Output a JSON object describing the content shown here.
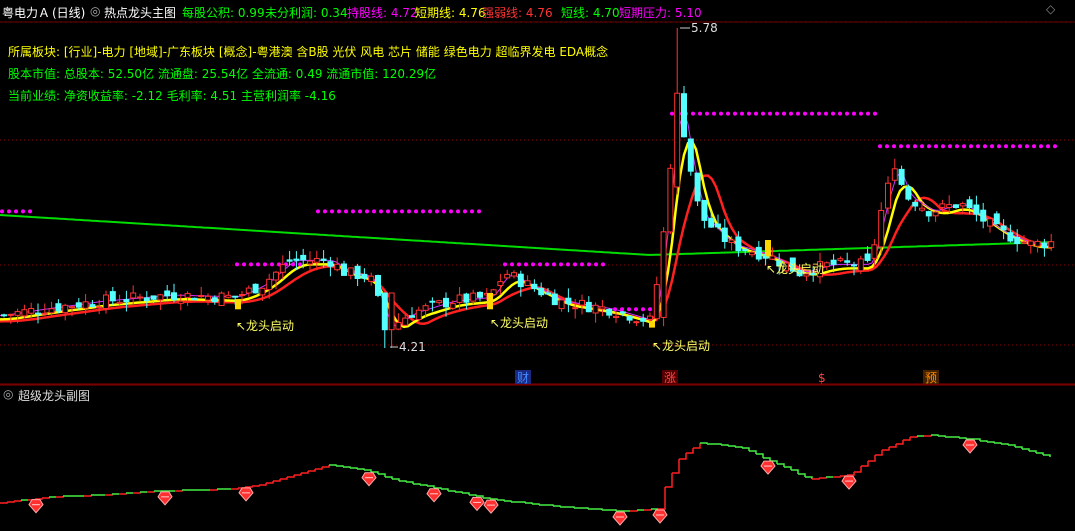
{
  "header": {
    "stock": "粤电力Ａ",
    "period": "(日线)",
    "main_indicator": "热点龙头主图",
    "indicators": [
      {
        "label": "每股公积: 0.99",
        "color": "#00ff00"
      },
      {
        "label": "未分利润: 0.34",
        "color": "#00ff00"
      },
      {
        "label": "持股线: 4.72",
        "color": "#ff00ff"
      },
      {
        "label": "短期线: 4.76",
        "color": "#ffff00"
      },
      {
        "label": "强弱线: 4.76",
        "color": "#ff3333"
      },
      {
        "label": "短线: 4.70",
        "color": "#00ff00"
      },
      {
        "label": "短期压力: 5.10",
        "color": "#ff00ff"
      }
    ]
  },
  "info_lines": {
    "sector": "所属板块: [行业]-电力 [地域]-广东板块 [概念]-粤港澳 含B股 光伏 风电 芯片 储能 绿色电力 超临界发电 EDA概念",
    "capital": "股本市值: 总股本: 52.50亿 流通盘: 25.54亿 全流通: 0.49 流通市值: 120.29亿",
    "performance": "当前业绩: 净资收益率: -2.12 毛利率: 4.51 主营利润率 -4.16"
  },
  "colors": {
    "up": "#ff3232",
    "down": "#54ffff",
    "ma_green": "#00dd00",
    "ma_red": "#ff2020",
    "ma_yellow": "#ffff00",
    "ma_purple": "#cc33ff",
    "pressure": "#ff00ff",
    "sub_up": "#ff2020",
    "sub_down": "#44ee44",
    "grid": "#8a0000"
  },
  "chart_data": {
    "type": "candlestick",
    "price_labels": {
      "high": "5.78",
      "low": "4.21"
    },
    "high_value": 5.78,
    "low_value": 4.21,
    "annotation_text": "↖龙头启动",
    "event_markers": [
      {
        "label": "财",
        "color": "#4488ff"
      },
      {
        "label": "涨",
        "color": "#ff4444"
      },
      {
        "label": "$",
        "color": "#ff4444"
      },
      {
        "label": "预",
        "color": "#ff8800"
      }
    ],
    "sub_chart_title": "超级龙头副图"
  }
}
